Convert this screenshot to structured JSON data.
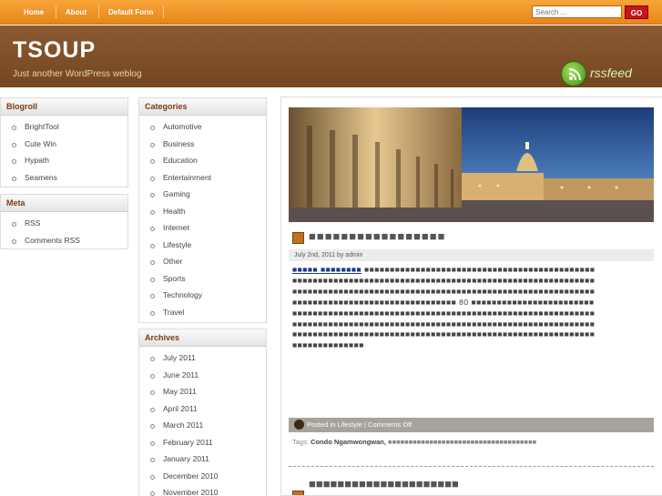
{
  "nav": {
    "links": [
      "Home",
      "About",
      "Default Form"
    ],
    "search_placeholder": "Search ...",
    "go_label": "GO"
  },
  "header": {
    "title": "TSOUP",
    "tagline": "Just another WordPress weblog",
    "rss_label": "rssfeed"
  },
  "blogroll": {
    "title": "Blogroll",
    "items": [
      "BrightTool",
      "Cute Win",
      "Hypath",
      "Seamens"
    ]
  },
  "meta": {
    "title": "Meta",
    "items": [
      "RSS",
      "Comments RSS"
    ]
  },
  "categories": {
    "title": "Categories",
    "items": [
      "Automotive",
      "Business",
      "Education",
      "Entertainment",
      "Gaming",
      "Health",
      "Internet",
      "Lifestyle",
      "Other",
      "Sports",
      "Technology",
      "Travel"
    ]
  },
  "archives": {
    "title": "Archives",
    "items": [
      "July 2011",
      "June 2011",
      "May 2011",
      "April 2011",
      "March 2011",
      "February 2011",
      "January 2011",
      "December 2010",
      "November 2010"
    ]
  },
  "post": {
    "title": "■■■■■■■■■■■■■■■■■",
    "meta": "July 2nd, 2011 by admin",
    "link_text": "■■■■■ ■■■■■■■■",
    "body": "■■■■■■■■■■■■■■■■■■■■■■■■■■■■■■■■■■■■■■■■■■■■■■■■■■■■■■■■■■■■■■■■■■■■■■■■■■■■■■■■■■■■■■■■■■■■■■■■■■■■■■■■■■■■■■■■■■■■■■■■■■■■■■■■■■■■■■■■■■■■■■■■■■■■■■■■■■■■■■■■■■■■■■■■■■■■■■■■■■■■■■■■■■■■■■■■■■■ 80 ■■■■■■■■■■■■■■■■■■■■■■■■■■■■■■■■■■■■■■■■■■■■■■■■■■■■■■■■■■■■■■■■■■■■■■■■■■■■■■■■■■■■■■■■■■■■■■■■■■■■■■■■■■■■■■■■■■■■■■■■■■■■■■■■■■■■■■■■■■■■■■■■■■■■■■■■■■■■■■■■■■■■■■■■■■■■■■■■■■■■■■■■■■■■■■■■■■■■■■■■■■■■■■■■■■■■■■■",
    "posted_in": "Posted in",
    "category": "Lifestyle",
    "comments": "Comments Off",
    "tags_label": "Tags:",
    "tag_author": "Condo Ngamwongwan,",
    "tag_rest": "■■■■■■■■■■■■■■■■■■■■■■■■■■■■■■■■■■■■",
    "next_title": "■■■■■■■■■■■■■■■■■■■■■"
  },
  "colors": {
    "nav_orange": "#f0962a",
    "header_brown": "#7f5029",
    "widget_title": "#7a3a14",
    "go_red": "#c8141a"
  }
}
